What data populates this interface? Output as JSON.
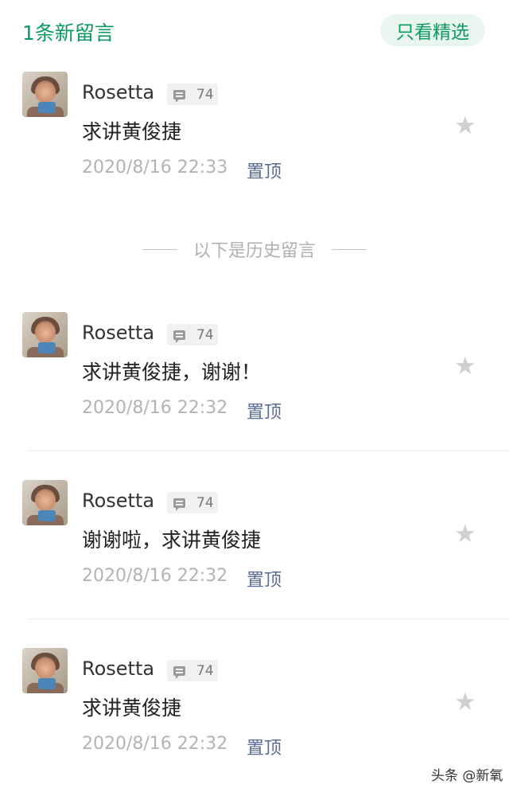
{
  "header": {
    "new_count_label": "1条新留言",
    "featured_label": "只看精选"
  },
  "history_label": "以下是历史留言",
  "comments": [
    {
      "name": "Rosetta",
      "badge_count": "74",
      "text": "求讲黄俊捷",
      "time": "2020/8/16 22:33",
      "pin_label": "置顶"
    },
    {
      "name": "Rosetta",
      "badge_count": "74",
      "text": "求讲黄俊捷，谢谢！",
      "time": "2020/8/16 22:32",
      "pin_label": "置顶"
    },
    {
      "name": "Rosetta",
      "badge_count": "74",
      "text": "谢谢啦，求讲黄俊捷",
      "time": "2020/8/16 22:32",
      "pin_label": "置顶"
    },
    {
      "name": "Rosetta",
      "badge_count": "74",
      "text": "求讲黄俊捷",
      "time": "2020/8/16 22:32",
      "pin_label": "置顶"
    }
  ],
  "watermark": "头条 @新氧",
  "colors": {
    "accent_green": "#0a9a5f",
    "pin_link": "#576b95",
    "muted_text": "#b3b3b3"
  },
  "icons": {
    "badge": "comment-icon",
    "star": "star-icon"
  }
}
